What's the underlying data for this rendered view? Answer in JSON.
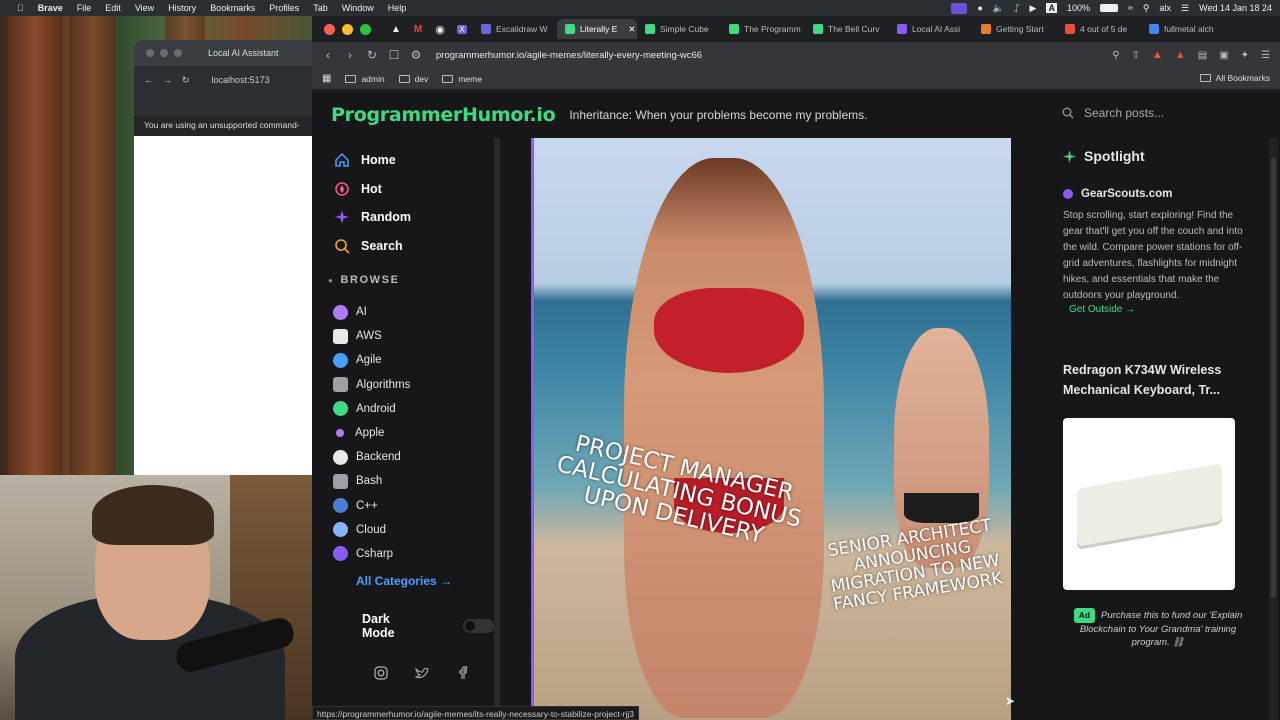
{
  "menubar": {
    "items": [
      "Brave",
      "File",
      "Edit",
      "View",
      "History",
      "Bookmarks",
      "Profiles",
      "Tab",
      "Window",
      "Help"
    ],
    "battery": "100%",
    "user": "alx",
    "datetime": "Wed 14 Jan  18 24"
  },
  "bg_window": {
    "tab_title": "Local AI Assistant",
    "address": "localhost:5173",
    "warning": "You are using an unsupported command-"
  },
  "browser": {
    "tabs": [
      {
        "label": "Excalidraw W",
        "color": "#6965db"
      },
      {
        "label": "Literally E",
        "color": "#3ddc84",
        "active": true
      },
      {
        "label": "Simple Cube",
        "color": "#3ddc84"
      },
      {
        "label": "The Programm",
        "color": "#3ddc84"
      },
      {
        "label": "The Bell Curv",
        "color": "#3ddc84"
      },
      {
        "label": "Local AI Assi",
        "color": "#8a5cf6"
      },
      {
        "label": "Getting Start",
        "color": "#e67e22"
      },
      {
        "label": "4 out of 5 de",
        "color": "#e74c3c"
      },
      {
        "label": "fullmetal alch",
        "color": "#4285f4"
      }
    ],
    "url": "programmerhumor.io/agile-memes/literally-every-meeting-wc66",
    "bookmarks": [
      "admin",
      "dev",
      "meme"
    ],
    "all_bookmarks": "All Bookmarks",
    "status_url": "https://programmerhumor.io/agile-memes/its-really-necessary-to-stabilize-project-rjj3"
  },
  "site": {
    "logo": "ProgrammerHumor.io",
    "tagline": "Inheritance: When your problems become my problems.",
    "search_placeholder": "Search posts...",
    "nav": [
      {
        "label": "Home",
        "icon": "home-icon",
        "color": "#4a9eff"
      },
      {
        "label": "Hot",
        "icon": "flame-icon",
        "color": "#ff5a8a"
      },
      {
        "label": "Random",
        "icon": "sparkle-icon",
        "color": "#8a5cf6"
      },
      {
        "label": "Search",
        "icon": "search-icon",
        "color": "#f5a623"
      }
    ],
    "browse_title": "BROWSE",
    "categories": [
      {
        "label": "AI",
        "color": "#b07cff"
      },
      {
        "label": "AWS",
        "color": "#e8e8e8"
      },
      {
        "label": "Agile",
        "color": "#4a9eff"
      },
      {
        "label": "Algorithms",
        "color": "#9aa0a6"
      },
      {
        "label": "Android",
        "color": "#3ddc84"
      },
      {
        "label": "Apple",
        "color": "#b07cff"
      },
      {
        "label": "Backend",
        "color": "#e8e8e8"
      },
      {
        "label": "Bash",
        "color": "#9aa0a6"
      },
      {
        "label": "C++",
        "color": "#4a7fd0"
      },
      {
        "label": "Cloud",
        "color": "#8ab4f8"
      },
      {
        "label": "Csharp",
        "color": "#8a5cf6"
      }
    ],
    "all_categories": "All Categories →",
    "dark_mode": "Dark Mode",
    "post": {
      "caption_left": "PROJECT MANAGER CALCULATING BONUS UPON DELIVERY",
      "caption_right": "SENIOR ARCHITECT ANNOUNCING MIGRATION TO NEW FANCY FRAMEWORK"
    },
    "spotlight": {
      "title": "Spotlight",
      "sponsor": "GearScouts.com",
      "description": "Stop scrolling, start exploring! Find the gear that'll get you off the couch and into the wild. Compare power stations for off-grid adventures, flashlights for midnight hikes, and essentials that make the outdoors your playground.",
      "cta": "Get Outside →",
      "product_title": "Redragon K734W Wireless Mechanical Keyboard, Tr...",
      "ad_badge": "Ad",
      "ad_text": "Purchase this to fund our 'Explain Blockchain to Your Grandma' training program. ⛓"
    }
  }
}
